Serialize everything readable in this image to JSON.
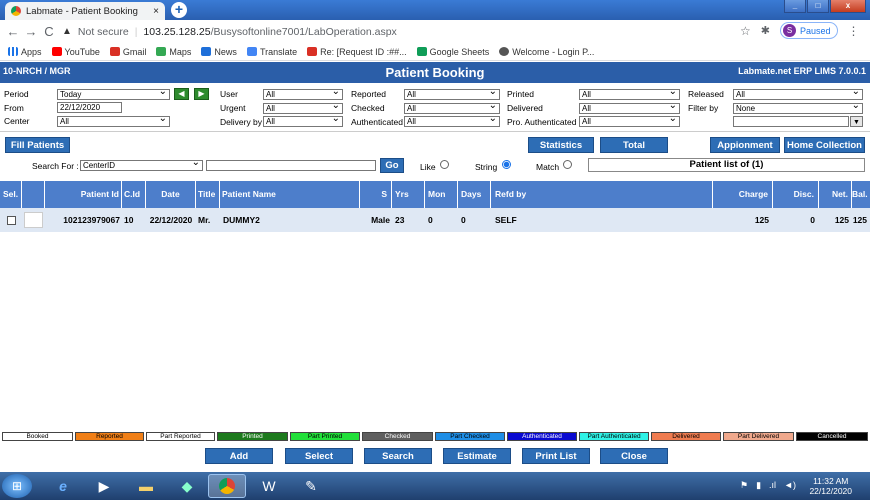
{
  "browser": {
    "tab_title": "Labmate - Patient Booking",
    "tab_close": "×",
    "new_tab": "+",
    "not_secure": "Not secure",
    "url_host": "103.25.128.25",
    "url_path": "/Busysoftonline7001/LabOperation.aspx",
    "profile_initial": "S",
    "profile_status": "Paused",
    "bookmarks": [
      "Apps",
      "YouTube",
      "Gmail",
      "Maps",
      "News",
      "Translate",
      "Re: [Request ID :##...",
      "Google Sheets",
      "Welcome - Login P..."
    ],
    "bookmark_colors": [
      "#4285f4",
      "#ff0000",
      "#d93025",
      "#34a853",
      "#1e6fd9",
      "#4285f4",
      "#d93025",
      "#0f9d58",
      "#555555"
    ]
  },
  "app": {
    "left_title": "10-NRCH / MGR",
    "center_title": "Patient Booking",
    "right_title": "Labmate.net ERP LIMS 7.0.0.1"
  },
  "filters": {
    "period_label": "Period",
    "period_value": "Today",
    "from_label": "From",
    "from_value": "22/12/2020",
    "center_label": "Center",
    "center_value": "All",
    "user_label": "User",
    "user_value": "All",
    "urgent_label": "Urgent",
    "urgent_value": "All",
    "delivery_label": "Delivery by",
    "delivery_value": "All",
    "reported_label": "Reported",
    "reported_value": "All",
    "checked_label": "Checked",
    "checked_value": "All",
    "authenticated_label": "Authenticated",
    "authenticated_value": "All",
    "printed_label": "Printed",
    "printed_value": "All",
    "delivered_label": "Delivered",
    "delivered_value": "All",
    "pro_auth_label": "Pro. Authenticated",
    "pro_auth_value": "All",
    "released_label": "Released",
    "released_value": "All",
    "filterby_label": "Filter by",
    "filterby_value": "None"
  },
  "actions": {
    "fill_patients": "Fill Patients",
    "statistics": "Statistics",
    "total": "Total",
    "appointment": "Appionment",
    "home_collection": "Home Collection"
  },
  "search": {
    "label": "Search For :",
    "field_value": "CenterID",
    "go": "Go",
    "like": "Like",
    "string": "String",
    "match": "Match",
    "list_title": "Patient list of (1)"
  },
  "grid": {
    "headers": [
      "Sel.",
      "",
      "Patient Id",
      "C.Id",
      "Date",
      "Title",
      "Patient Name",
      "S",
      "Yrs",
      "Mon",
      "Days",
      "Refd by",
      "Charge",
      "Disc.",
      "Net.",
      "Bal."
    ],
    "row": {
      "patient_id": "102123979067",
      "cid": "10",
      "date": "22/12/2020",
      "title": "Mr.",
      "name": "DUMMY2",
      "sex": "Male",
      "yrs": "23",
      "mon": "0",
      "days": "0",
      "refd_by": "SELF",
      "charge": "125",
      "disc": "0",
      "net": "125",
      "bal": "125"
    }
  },
  "legend": [
    {
      "label": "Booked",
      "bg": "#ffffff",
      "fg": "#000000"
    },
    {
      "label": "Reported",
      "bg": "#f07f17",
      "fg": "#000000"
    },
    {
      "label": "Part Reported",
      "bg": "#ffffff",
      "fg": "#000000"
    },
    {
      "label": "Printed",
      "bg": "#1d7a1d",
      "fg": "#ffffff"
    },
    {
      "label": "Part Printed",
      "bg": "#22e03a",
      "fg": "#000000"
    },
    {
      "label": "Checked",
      "bg": "#5f5f5f",
      "fg": "#ffffff"
    },
    {
      "label": "Part Checked",
      "bg": "#1e8ee6",
      "fg": "#000000"
    },
    {
      "label": "Authenticated",
      "bg": "#0a0ad0",
      "fg": "#ffffff"
    },
    {
      "label": "Part Authenticated",
      "bg": "#2ff2e6",
      "fg": "#000000"
    },
    {
      "label": "Delivered",
      "bg": "#ef7c50",
      "fg": "#000000"
    },
    {
      "label": "Part Delivered",
      "bg": "#f0a98d",
      "fg": "#000000"
    },
    {
      "label": "Cancelled",
      "bg": "#000000",
      "fg": "#ffffff"
    }
  ],
  "bottom_buttons": [
    "Add",
    "Select",
    "Search",
    "Estimate",
    "Print List",
    "Close"
  ],
  "taskbar": {
    "time": "11:32 AM",
    "date": "22/12/2020"
  }
}
